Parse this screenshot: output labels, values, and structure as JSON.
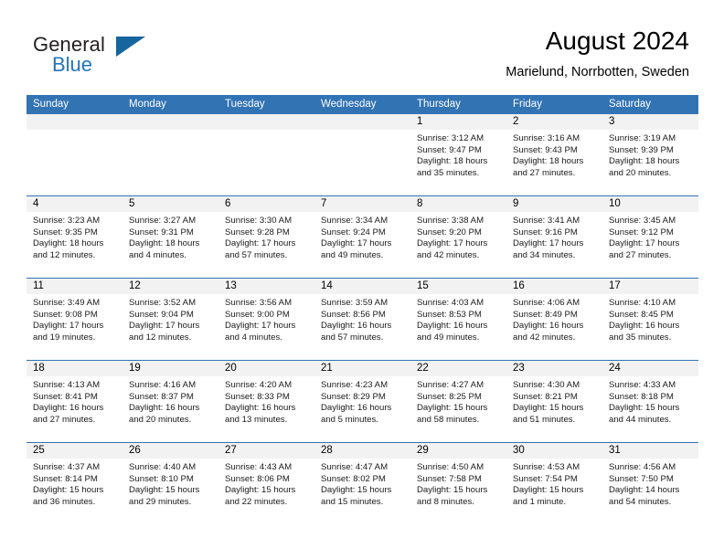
{
  "logo": {
    "text_top": "General",
    "text_bottom": "Blue",
    "triangle": "triangle-icon",
    "color_dark": "#231f20",
    "color_blue": "#2176bd"
  },
  "header": {
    "title": "August 2024",
    "subtitle": "Marielund, Norrbotten, Sweden"
  },
  "theme": {
    "header_blue": "#3273b4",
    "daynum_band": "#f2f2f2",
    "text": "#000000"
  },
  "weekdays": [
    "Sunday",
    "Monday",
    "Tuesday",
    "Wednesday",
    "Thursday",
    "Friday",
    "Saturday"
  ],
  "weeks": [
    [
      {
        "day": "",
        "empty": true
      },
      {
        "day": "",
        "empty": true
      },
      {
        "day": "",
        "empty": true
      },
      {
        "day": "",
        "empty": true
      },
      {
        "day": "1",
        "sunrise": "Sunrise: 3:12 AM",
        "sunset": "Sunset: 9:47 PM",
        "daylight_line1": "Daylight: 18 hours",
        "daylight_line2": "and 35 minutes."
      },
      {
        "day": "2",
        "sunrise": "Sunrise: 3:16 AM",
        "sunset": "Sunset: 9:43 PM",
        "daylight_line1": "Daylight: 18 hours",
        "daylight_line2": "and 27 minutes."
      },
      {
        "day": "3",
        "sunrise": "Sunrise: 3:19 AM",
        "sunset": "Sunset: 9:39 PM",
        "daylight_line1": "Daylight: 18 hours",
        "daylight_line2": "and 20 minutes."
      }
    ],
    [
      {
        "day": "4",
        "sunrise": "Sunrise: 3:23 AM",
        "sunset": "Sunset: 9:35 PM",
        "daylight_line1": "Daylight: 18 hours",
        "daylight_line2": "and 12 minutes."
      },
      {
        "day": "5",
        "sunrise": "Sunrise: 3:27 AM",
        "sunset": "Sunset: 9:31 PM",
        "daylight_line1": "Daylight: 18 hours",
        "daylight_line2": "and 4 minutes."
      },
      {
        "day": "6",
        "sunrise": "Sunrise: 3:30 AM",
        "sunset": "Sunset: 9:28 PM",
        "daylight_line1": "Daylight: 17 hours",
        "daylight_line2": "and 57 minutes."
      },
      {
        "day": "7",
        "sunrise": "Sunrise: 3:34 AM",
        "sunset": "Sunset: 9:24 PM",
        "daylight_line1": "Daylight: 17 hours",
        "daylight_line2": "and 49 minutes."
      },
      {
        "day": "8",
        "sunrise": "Sunrise: 3:38 AM",
        "sunset": "Sunset: 9:20 PM",
        "daylight_line1": "Daylight: 17 hours",
        "daylight_line2": "and 42 minutes."
      },
      {
        "day": "9",
        "sunrise": "Sunrise: 3:41 AM",
        "sunset": "Sunset: 9:16 PM",
        "daylight_line1": "Daylight: 17 hours",
        "daylight_line2": "and 34 minutes."
      },
      {
        "day": "10",
        "sunrise": "Sunrise: 3:45 AM",
        "sunset": "Sunset: 9:12 PM",
        "daylight_line1": "Daylight: 17 hours",
        "daylight_line2": "and 27 minutes."
      }
    ],
    [
      {
        "day": "11",
        "sunrise": "Sunrise: 3:49 AM",
        "sunset": "Sunset: 9:08 PM",
        "daylight_line1": "Daylight: 17 hours",
        "daylight_line2": "and 19 minutes."
      },
      {
        "day": "12",
        "sunrise": "Sunrise: 3:52 AM",
        "sunset": "Sunset: 9:04 PM",
        "daylight_line1": "Daylight: 17 hours",
        "daylight_line2": "and 12 minutes."
      },
      {
        "day": "13",
        "sunrise": "Sunrise: 3:56 AM",
        "sunset": "Sunset: 9:00 PM",
        "daylight_line1": "Daylight: 17 hours",
        "daylight_line2": "and 4 minutes."
      },
      {
        "day": "14",
        "sunrise": "Sunrise: 3:59 AM",
        "sunset": "Sunset: 8:56 PM",
        "daylight_line1": "Daylight: 16 hours",
        "daylight_line2": "and 57 minutes."
      },
      {
        "day": "15",
        "sunrise": "Sunrise: 4:03 AM",
        "sunset": "Sunset: 8:53 PM",
        "daylight_line1": "Daylight: 16 hours",
        "daylight_line2": "and 49 minutes."
      },
      {
        "day": "16",
        "sunrise": "Sunrise: 4:06 AM",
        "sunset": "Sunset: 8:49 PM",
        "daylight_line1": "Daylight: 16 hours",
        "daylight_line2": "and 42 minutes."
      },
      {
        "day": "17",
        "sunrise": "Sunrise: 4:10 AM",
        "sunset": "Sunset: 8:45 PM",
        "daylight_line1": "Daylight: 16 hours",
        "daylight_line2": "and 35 minutes."
      }
    ],
    [
      {
        "day": "18",
        "sunrise": "Sunrise: 4:13 AM",
        "sunset": "Sunset: 8:41 PM",
        "daylight_line1": "Daylight: 16 hours",
        "daylight_line2": "and 27 minutes."
      },
      {
        "day": "19",
        "sunrise": "Sunrise: 4:16 AM",
        "sunset": "Sunset: 8:37 PM",
        "daylight_line1": "Daylight: 16 hours",
        "daylight_line2": "and 20 minutes."
      },
      {
        "day": "20",
        "sunrise": "Sunrise: 4:20 AM",
        "sunset": "Sunset: 8:33 PM",
        "daylight_line1": "Daylight: 16 hours",
        "daylight_line2": "and 13 minutes."
      },
      {
        "day": "21",
        "sunrise": "Sunrise: 4:23 AM",
        "sunset": "Sunset: 8:29 PM",
        "daylight_line1": "Daylight: 16 hours",
        "daylight_line2": "and 5 minutes."
      },
      {
        "day": "22",
        "sunrise": "Sunrise: 4:27 AM",
        "sunset": "Sunset: 8:25 PM",
        "daylight_line1": "Daylight: 15 hours",
        "daylight_line2": "and 58 minutes."
      },
      {
        "day": "23",
        "sunrise": "Sunrise: 4:30 AM",
        "sunset": "Sunset: 8:21 PM",
        "daylight_line1": "Daylight: 15 hours",
        "daylight_line2": "and 51 minutes."
      },
      {
        "day": "24",
        "sunrise": "Sunrise: 4:33 AM",
        "sunset": "Sunset: 8:18 PM",
        "daylight_line1": "Daylight: 15 hours",
        "daylight_line2": "and 44 minutes."
      }
    ],
    [
      {
        "day": "25",
        "sunrise": "Sunrise: 4:37 AM",
        "sunset": "Sunset: 8:14 PM",
        "daylight_line1": "Daylight: 15 hours",
        "daylight_line2": "and 36 minutes."
      },
      {
        "day": "26",
        "sunrise": "Sunrise: 4:40 AM",
        "sunset": "Sunset: 8:10 PM",
        "daylight_line1": "Daylight: 15 hours",
        "daylight_line2": "and 29 minutes."
      },
      {
        "day": "27",
        "sunrise": "Sunrise: 4:43 AM",
        "sunset": "Sunset: 8:06 PM",
        "daylight_line1": "Daylight: 15 hours",
        "daylight_line2": "and 22 minutes."
      },
      {
        "day": "28",
        "sunrise": "Sunrise: 4:47 AM",
        "sunset": "Sunset: 8:02 PM",
        "daylight_line1": "Daylight: 15 hours",
        "daylight_line2": "and 15 minutes."
      },
      {
        "day": "29",
        "sunrise": "Sunrise: 4:50 AM",
        "sunset": "Sunset: 7:58 PM",
        "daylight_line1": "Daylight: 15 hours",
        "daylight_line2": "and 8 minutes."
      },
      {
        "day": "30",
        "sunrise": "Sunrise: 4:53 AM",
        "sunset": "Sunset: 7:54 PM",
        "daylight_line1": "Daylight: 15 hours",
        "daylight_line2": "and 1 minute."
      },
      {
        "day": "31",
        "sunrise": "Sunrise: 4:56 AM",
        "sunset": "Sunset: 7:50 PM",
        "daylight_line1": "Daylight: 14 hours",
        "daylight_line2": "and 54 minutes."
      }
    ]
  ]
}
